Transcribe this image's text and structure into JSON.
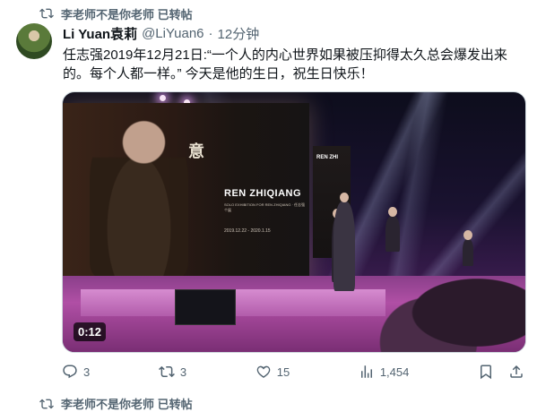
{
  "repost": {
    "label": "李老师不是你老师 已转帖",
    "icon": "repost-icon"
  },
  "tweet": {
    "author_name": "Li Yuan袁莉",
    "author_handle": "@LiYuan6",
    "separator": "·",
    "time": "12分钟",
    "text": "任志强2019年12月21日:“一个人的内心世界如果被压抑得太久总会爆发出来的。每个人都一样。” 今天是他的生日，祝生日快乐！"
  },
  "media": {
    "duration": "0:12",
    "screen_title": "REN ZHIQIANG",
    "screen_subtitle": "SOLO EXHIBITION FOR REN ZHIQIANG · 任志强个展",
    "screen_date": "2019.12.22 - 2020.1.15",
    "screen_art_text": "意",
    "side_screen_text": "REN ZHI"
  },
  "actions": {
    "replies": "3",
    "reposts": "3",
    "likes": "15",
    "views": "1,454"
  },
  "next_repost": {
    "label": "李老师不是你老师 已转帖"
  }
}
